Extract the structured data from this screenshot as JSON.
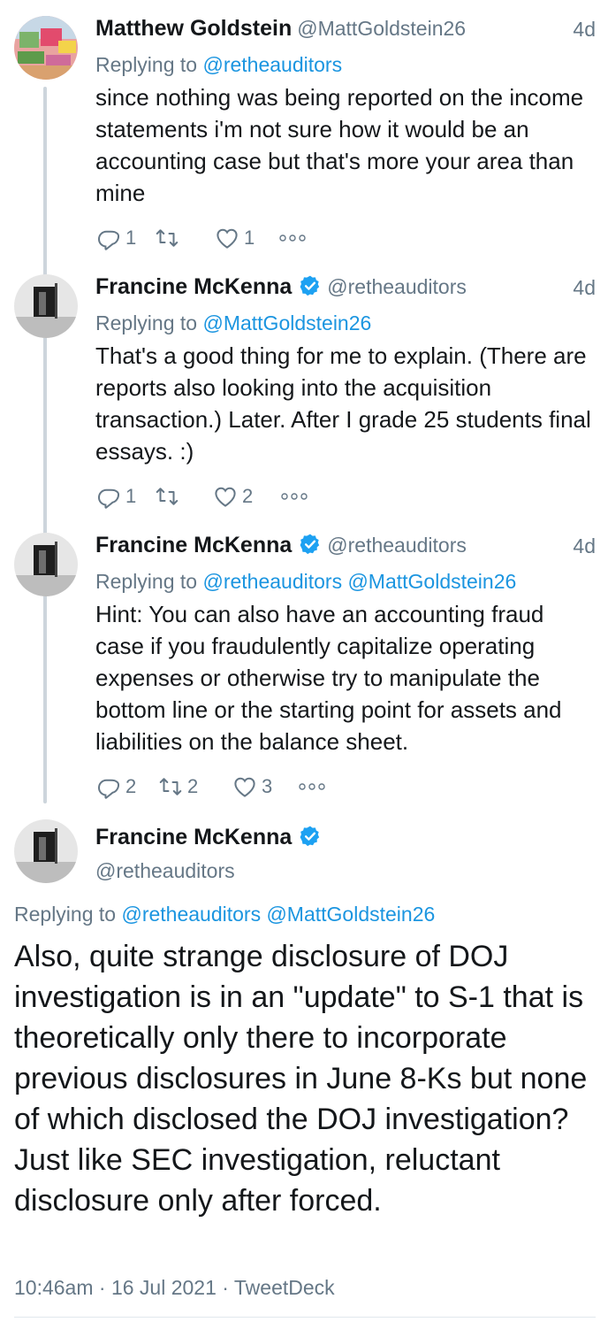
{
  "tweets": [
    {
      "name": "Matthew Goldstein",
      "handle": "@MattGoldstein26",
      "time": "4d",
      "verified": false,
      "replying_label": "Replying to",
      "replying_to": "@retheauditors",
      "text": "since nothing was being reported on the income statements i'm not sure how it would be an accounting case but that's more your area than mine",
      "replies": "1",
      "retweets": "",
      "likes": "1"
    },
    {
      "name": "Francine McKenna",
      "handle": "@retheauditors",
      "time": "4d",
      "verified": true,
      "replying_label": "Replying to",
      "replying_to": "@MattGoldstein26",
      "text": "That's a good thing for me to explain. (There are reports also looking into the acquisition transaction.) Later.  After I grade 25 students final essays.  :)",
      "replies": "1",
      "retweets": "",
      "likes": "2"
    },
    {
      "name": "Francine McKenna",
      "handle": "@retheauditors",
      "time": "4d",
      "verified": true,
      "replying_label": "Replying to",
      "replying_to": "@retheauditors @MattGoldstein26",
      "text": "Hint: You can also have an accounting fraud case if you fraudulently capitalize operating expenses or otherwise try to manipulate the bottom line or the starting point for assets and liabilities on the balance sheet.",
      "replies": "2",
      "retweets": "2",
      "likes": "3"
    }
  ],
  "main_tweet": {
    "name": "Francine McKenna",
    "handle": "@retheauditors",
    "verified": true,
    "replying_label": "Replying to",
    "replying_to": "@retheauditors @MattGoldstein26",
    "text": "Also, quite strange disclosure of DOJ investigation is in an \"update\" to S-1 that is theoretically only there to incorporate previous disclosures in June 8-Ks but none of which disclosed the DOJ investigation?  Just like SEC investigation, reluctant disclosure only after forced.",
    "timestamp": "10:46am · 16 Jul 2021 · TweetDeck"
  },
  "colors": {
    "accent": "#1b95e0",
    "muted": "#657786",
    "thread_line": "#cdd5dc",
    "verified": "#1da1f2"
  },
  "icons": [
    "reply-icon",
    "retweet-icon",
    "like-icon",
    "more-icon",
    "verified-badge-icon"
  ]
}
